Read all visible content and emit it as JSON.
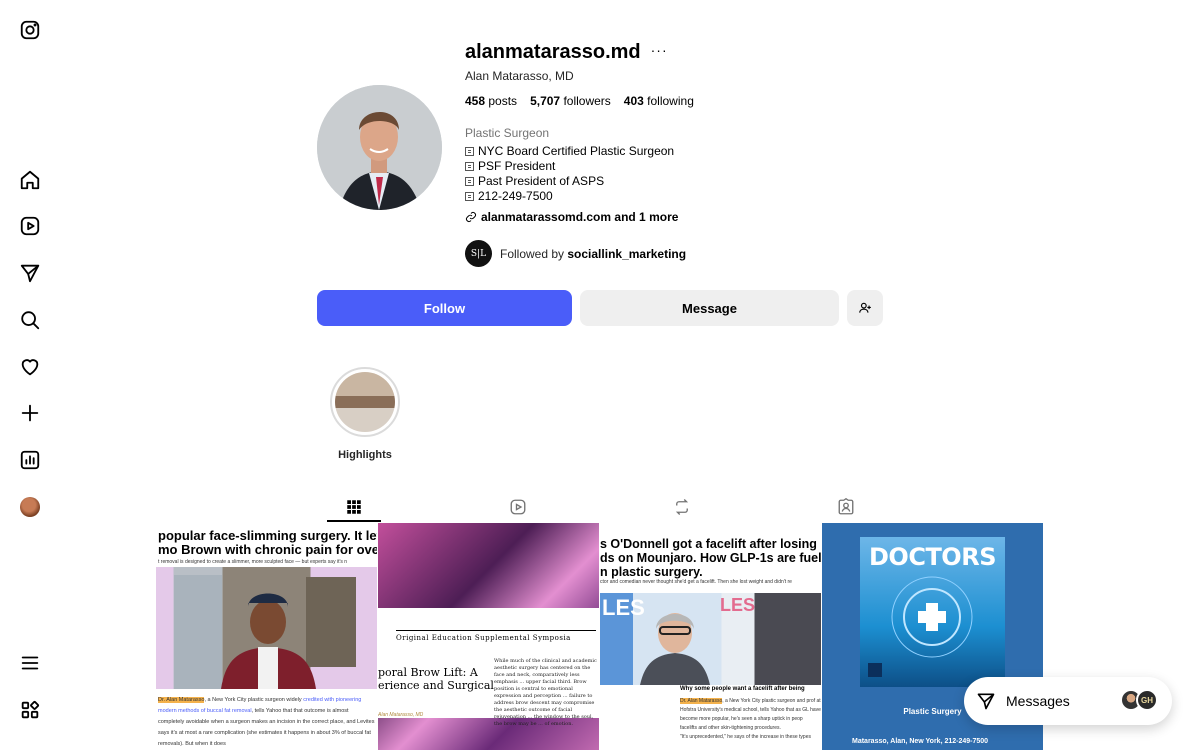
{
  "sidebar": {
    "items": [
      {
        "name": "instagram-logo-icon"
      },
      {
        "name": "home-icon"
      },
      {
        "name": "reels-icon"
      },
      {
        "name": "direct-send-icon"
      },
      {
        "name": "search-icon"
      },
      {
        "name": "heart-icon"
      },
      {
        "name": "create-plus-icon"
      },
      {
        "name": "dashboard-icon"
      },
      {
        "name": "profile-avatar"
      },
      {
        "name": "menu-icon"
      },
      {
        "name": "more-apps-icon"
      }
    ]
  },
  "profile": {
    "username": "alanmatarasso.md",
    "more": "···",
    "full_name": "Alan Matarasso, MD",
    "stats": {
      "posts_count": "458",
      "posts_label": "posts",
      "followers_count": "5,707",
      "followers_label": "followers",
      "following_count": "403",
      "following_label": "following"
    },
    "category": "Plastic Surgeon",
    "bio": [
      "NYC Board Certified Plastic Surgeon",
      "PSF President",
      "Past President of ASPS",
      "212-249-7500"
    ],
    "link": "alanmatarassomd.com and 1 more",
    "followed_by_prefix": "Followed by",
    "followed_by_user": "sociallink_marketing",
    "followed_by_avatar_text": "S|L"
  },
  "actions": {
    "follow_label": "Follow",
    "message_label": "Message"
  },
  "highlights": [
    {
      "label": "Highlights"
    }
  ],
  "tabs": [
    {
      "name": "posts-grid-icon",
      "active": true
    },
    {
      "name": "reels-icon",
      "active": false
    },
    {
      "name": "reposts-icon",
      "active": false
    },
    {
      "name": "tagged-icon",
      "active": false
    }
  ],
  "posts": {
    "p1": {
      "headline_1": "popular face-slimming surgery. It left",
      "headline_2": "mo Brown with chronic pain for over a",
      "kicker": "t removal is designed to create a slimmer, more sculpted face — but experts say it's n",
      "body_hl": "Dr. Alan Matarasso",
      "body_1": ", a New York City plastic surgeon widely",
      "body_link": "credited with pioneering modern methods of buccal fat removal",
      "body_2": ", tells Yahoo that that outcome is almost completely avoidable when a surgeon makes an incision in the correct place, and Levites says it's at most a rare complication (she estimates it happens in about 3% of buccal fat removals). But when it does"
    },
    "p2": {
      "symposia": "Original Education Supplemental Symposia",
      "brow_1": "poral Brow Lift: A",
      "brow_2": "erience and Surgical",
      "author": "Alan Matarasso, MD",
      "column": "While much of the clinical and academic aesthetic surgery has centered on the face and neck, comparatively less emphasis ... upper facial third. Brow position is central to emotional expression and perception ... failure to address brow descent may compromise the aesthetic outcome of facial rejuvenation ... the window to the soul, the brow may be ... of emotion."
    },
    "p3": {
      "headline_1": "s O'Donnell got a facelift after losing",
      "headline_2": "ds on Mounjaro. How GLP-1s are fuel",
      "headline_3": "n plastic surgery.",
      "kicker": "ctor and comedian never thought she'd get a facelift. Then she lost weight and didn't re",
      "caption": "Why some people want a facelift after being",
      "body_hl": "Dr. Alan Matarasso",
      "body": ", a New York City plastic surgeon and prof at Hofstra University's medical school, tells Yahoo that as GL have become more popular, he's seen a sharp uptick in peop facelifts and other skin-tightening procedures.",
      "quote": "\"It's unprecedented,\" he says of the increase in these types"
    },
    "p4": {
      "title": "DOCTORS",
      "subtitle": "Plastic Surgery",
      "address": "Matarasso, Alan, New York, 212-249-7500"
    }
  },
  "messages": {
    "label": "Messages",
    "avatar_b_text": "GH"
  },
  "colors": {
    "follow_button": "#4a5df9",
    "secondary_button": "#efefef",
    "muted_text": "#737373"
  }
}
